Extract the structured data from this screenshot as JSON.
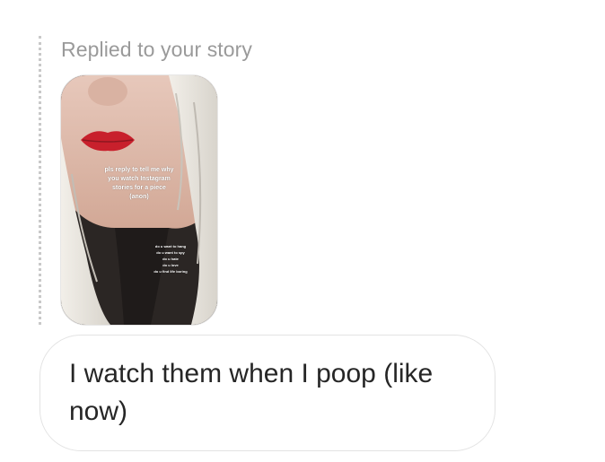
{
  "reply": {
    "label": "Replied to your story"
  },
  "story": {
    "caption_lines": [
      "pls reply to tell me why",
      "you watch Instagram",
      "stories for a piece",
      "(anon)"
    ],
    "options": [
      "do u want to hang",
      "do u want to spy",
      "do u hate",
      "do u love",
      "do u find life boring"
    ]
  },
  "message": {
    "text": "I watch them when I poop (like now)"
  },
  "colors": {
    "bubble_border": "#e3e3e3",
    "label_gray": "#9a9a9a",
    "text_dark": "#262626",
    "lips_red": "#c8202c"
  }
}
